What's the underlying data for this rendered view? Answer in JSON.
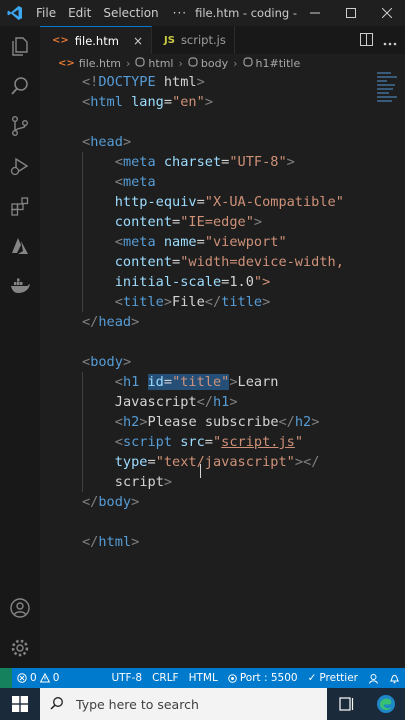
{
  "titlebar": {
    "menu": [
      "File",
      "Edit",
      "Selection",
      "···"
    ],
    "window_title": "file.htm - coding -..."
  },
  "tabs": [
    {
      "icon": "<>",
      "label": "file.htm",
      "active": true,
      "close": "×"
    },
    {
      "icon": "JS",
      "label": "script.js",
      "active": false
    }
  ],
  "breadcrumb": {
    "file_icon": "<>",
    "items": [
      "file.htm",
      "html",
      "body",
      "h1#title"
    ],
    "separator": "›"
  },
  "code": {
    "lines": [
      "<!DOCTYPE html>",
      "<html lang=\"en\">",
      "",
      "<head>",
      "    <meta charset=\"UTF-8\">",
      "    <meta",
      "    http-equiv=\"X-UA-Compatible\"",
      "    content=\"IE=edge\">",
      "    <meta name=\"viewport\"",
      "    content=\"width=device-width,",
      "    initial-scale=1.0\">",
      "    <title>File</title>",
      "</head>",
      "",
      "<body>",
      "    <h1 id=\"title\">Learn",
      "    Javascript</h1>",
      "    <h2>Please subscribe</h2>",
      "    <script src=\"script.js\"",
      "    type=\"text/javascript\"></",
      "    script>",
      "</body>",
      "",
      "</html>"
    ]
  },
  "statusbar": {
    "errors": "0",
    "warnings": "0",
    "encoding": "UTF-8",
    "eol": "CRLF",
    "language": "HTML",
    "port": "Port : 5500",
    "prettier": "Prettier"
  },
  "taskbar": {
    "search_placeholder": "Type here to search"
  },
  "colors": {
    "accent": "#007acc",
    "tag": "#569cd6",
    "attr_name": "#9cdcfe",
    "attr_value": "#ce9178",
    "bracket": "#808080",
    "text": "#d4d4d4"
  }
}
